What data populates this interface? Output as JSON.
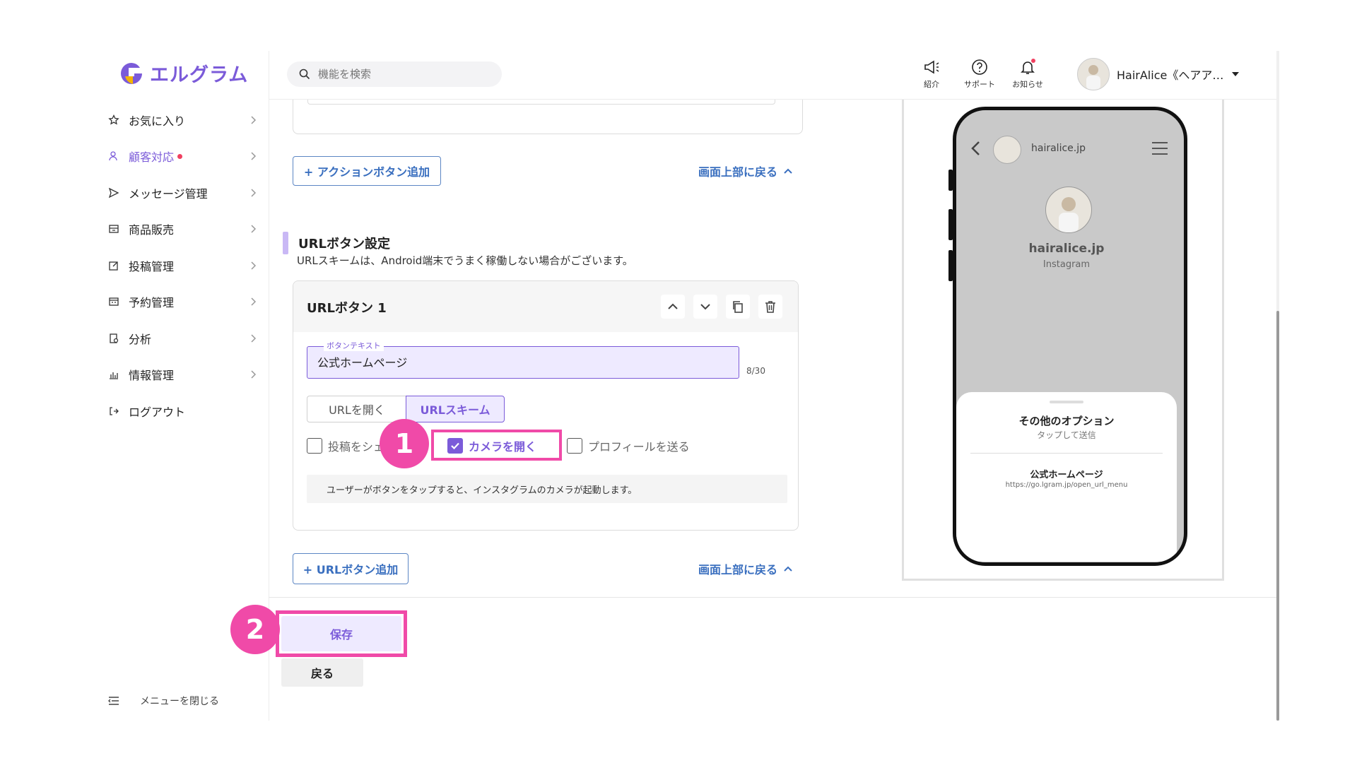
{
  "app": {
    "name": "エルグラム"
  },
  "search": {
    "placeholder": "機能を検索"
  },
  "header": {
    "intro_label": "紹介",
    "support_label": "サポート",
    "notify_label": "お知らせ",
    "user_name": "HairAlice《ヘアア…"
  },
  "sidebar": {
    "items": [
      {
        "label": "お気に入り"
      },
      {
        "label": "顧客対応"
      },
      {
        "label": "メッセージ管理"
      },
      {
        "label": "商品販売"
      },
      {
        "label": "投稿管理"
      },
      {
        "label": "予約管理"
      },
      {
        "label": "分析"
      },
      {
        "label": "情報管理"
      },
      {
        "label": "ログアウト"
      }
    ],
    "close_label": "メニューを閉じる"
  },
  "main": {
    "add_action_button": "+ アクションボタン追加",
    "back_to_top": "画面上部に戻る",
    "section_title": "URLボタン設定",
    "section_note": "URLスキームは、Android端末でうまく稼働しない場合がございます。",
    "url_button_card": {
      "title": "URLボタン 1",
      "field_label": "ボタンテキスト",
      "field_value": "公式ホームページ",
      "char_count": "8/30",
      "tab_open_url": "URLを開く",
      "tab_url_scheme": "URLスキーム",
      "option_share_post": "投稿をシェ",
      "option_open_camera": "カメラを開く",
      "option_send_profile": "プロフィールを送る",
      "info_text": "ユーザーがボタンをタップすると、インスタグラムのカメラが起動します。"
    },
    "add_url_button": "+ URLボタン追加",
    "back_to_top_2": "画面上部に戻る"
  },
  "footer": {
    "save_label": "保存",
    "back_label": "戻る"
  },
  "annotations": {
    "badge1": "1",
    "badge2": "2"
  },
  "phone_preview": {
    "username_top": "hairalice.jp",
    "profile_name": "hairalice.jp",
    "profile_sub": "Instagram",
    "sheet_title": "その他のオプション",
    "sheet_sub": "タップして送信",
    "item_title": "公式ホームページ",
    "item_url": "https://go.lgram.jp/open_url_menu"
  },
  "colors": {
    "brand": "#7b5bd9",
    "link_blue": "#3a6fbf",
    "highlight_pink": "#f04aa8",
    "input_bg": "#eeeaff"
  }
}
